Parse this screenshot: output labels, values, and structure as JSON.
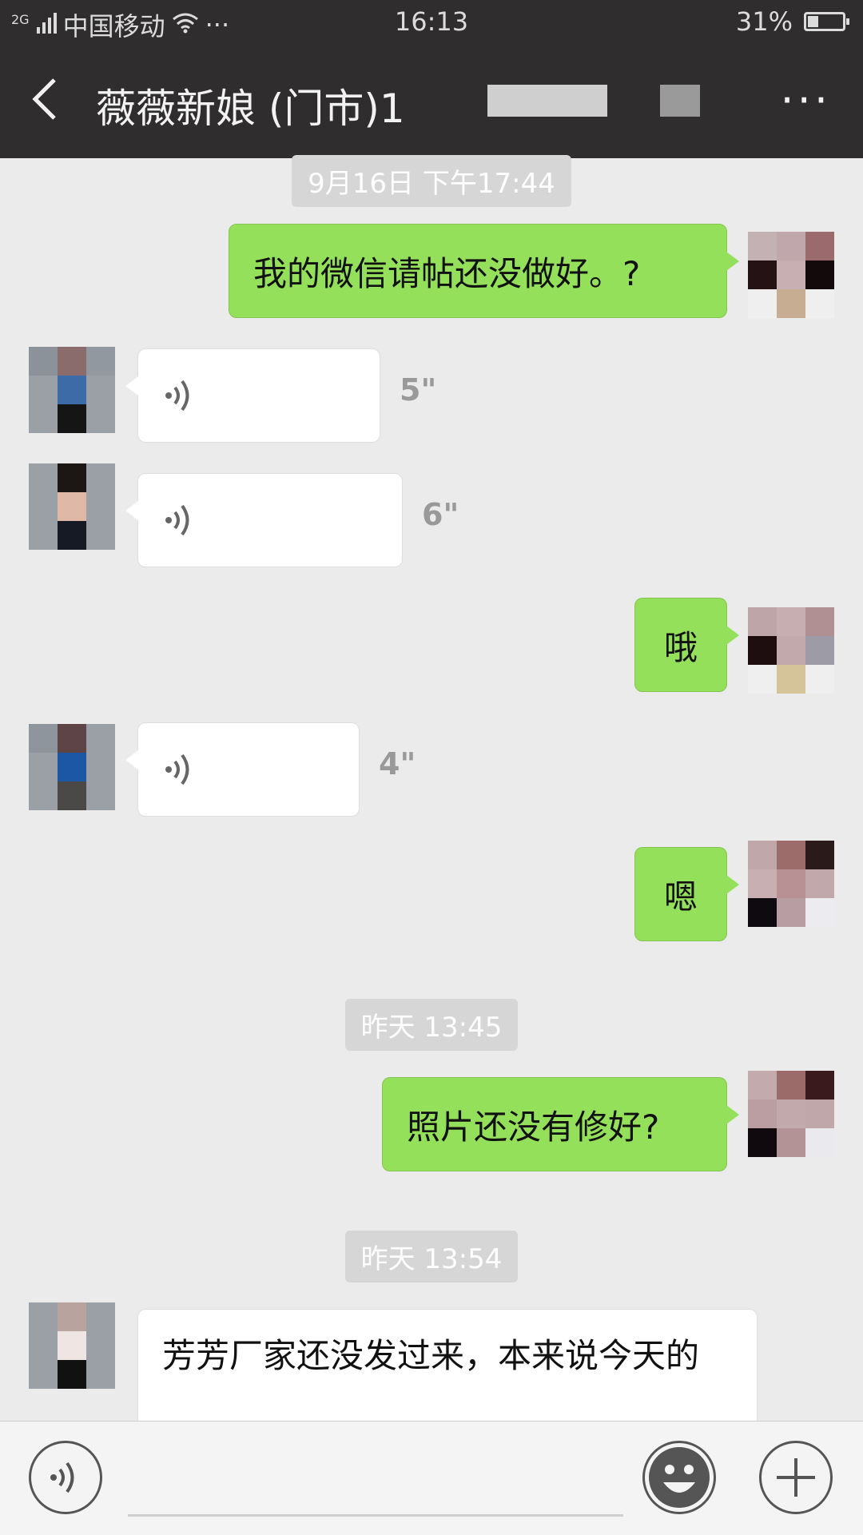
{
  "status_bar": {
    "network": "2G",
    "carrier": "中国移动",
    "dots": "···",
    "time": "16:13",
    "battery_percent": "31%",
    "battery_level": 0.31
  },
  "header": {
    "title": "薇薇新娘    (门市)1",
    "more": "···"
  },
  "messages": [
    {
      "type": "timestamp",
      "text": "9月16日 下午17:44"
    },
    {
      "type": "text",
      "side": "outgoing",
      "text": "我的微信请帖还没做好。?"
    },
    {
      "type": "voice",
      "side": "incoming",
      "duration": "5\""
    },
    {
      "type": "voice",
      "side": "incoming",
      "duration": "6\""
    },
    {
      "type": "text",
      "side": "outgoing",
      "text": "哦"
    },
    {
      "type": "voice",
      "side": "incoming",
      "duration": "4\""
    },
    {
      "type": "text",
      "side": "outgoing",
      "text": "嗯"
    },
    {
      "type": "timestamp",
      "text": "昨天 13:45"
    },
    {
      "type": "text",
      "side": "outgoing",
      "text": "照片还没有修好?"
    },
    {
      "type": "timestamp",
      "text": "昨天 13:54"
    },
    {
      "type": "text",
      "side": "incoming",
      "text": "芳芳厂家还没发过来，本来说今天的"
    }
  ],
  "input_bar": {
    "voice_icon": "voice-icon",
    "emoji_icon": "emoji-icon",
    "plus_icon": "plus-icon"
  },
  "colors": {
    "outgoing_bubble": "#95e05a",
    "incoming_bubble": "#ffffff",
    "header_bg": "#2f2d2e",
    "chat_bg": "#ebebeb"
  }
}
